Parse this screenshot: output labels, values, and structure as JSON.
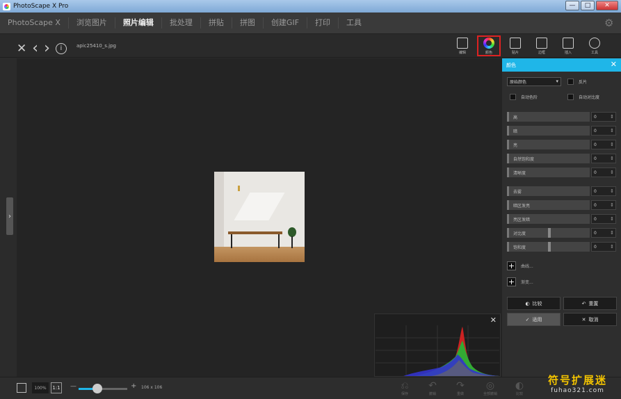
{
  "window": {
    "title": "PhotoScape X Pro",
    "minimize_label": "—",
    "maximize_label": "□",
    "close_label": "✕"
  },
  "menu": {
    "items": [
      {
        "label": "PhotoScape X"
      },
      {
        "label": "浏览图片"
      },
      {
        "label": "照片编辑",
        "active": true
      },
      {
        "label": "批处理"
      },
      {
        "label": "拼贴"
      },
      {
        "label": "拼图"
      },
      {
        "label": "创建GIF"
      },
      {
        "label": "打印"
      },
      {
        "label": "工具"
      }
    ],
    "settings_icon": "gear-icon"
  },
  "toolbar": {
    "close_glyph": "✕",
    "prev_glyph": "‹",
    "next_glyph": "›",
    "info_glyph": "i",
    "filename": "apic25410_s.jpg",
    "tools": [
      {
        "label": "编辑"
      },
      {
        "label": "颜色",
        "selected": true
      },
      {
        "label": "贴片"
      },
      {
        "label": "边框"
      },
      {
        "label": "插入"
      },
      {
        "label": "工具"
      }
    ]
  },
  "color_panel": {
    "title": "颜色",
    "close_glyph": "✕",
    "mode_select": "原始颜色",
    "checkboxes": [
      "反片",
      "自动色阶",
      "自动对比度"
    ],
    "sliders": [
      {
        "label": "高",
        "value": "0"
      },
      {
        "label": "暗",
        "value": "0"
      },
      {
        "label": "亮",
        "value": "0"
      },
      {
        "label": "自然饱和度",
        "value": "0"
      },
      {
        "label": "清晰度",
        "value": "0"
      },
      {
        "label": "去雾",
        "value": "0"
      },
      {
        "label": "暗区发亮",
        "value": "0"
      },
      {
        "label": "亮区发暗",
        "value": "0"
      },
      {
        "label": "对比度",
        "value": "0"
      },
      {
        "label": "饱和度",
        "value": "0"
      }
    ],
    "add_rows": [
      "曲线...",
      "渐变..."
    ],
    "buttons": {
      "compare": "比较",
      "reset": "重置",
      "apply": "适用",
      "cancel": "取消"
    }
  },
  "histogram": {
    "close_glyph": "✕"
  },
  "statusbar": {
    "zoom": "100%",
    "one_to_one": "1:1",
    "minus": "—",
    "plus": "+",
    "dimensions": "106 x 106",
    "actions": [
      "保存",
      "撤销",
      "重做",
      "全部撤销",
      "比较",
      "保存"
    ]
  },
  "watermark": {
    "line1": "符号扩展迷",
    "line2": "fuhao321.com"
  },
  "colors": {
    "accent": "#1fb6e8",
    "highlight": "#dd2222",
    "watermark_yellow": "#f4c400"
  }
}
